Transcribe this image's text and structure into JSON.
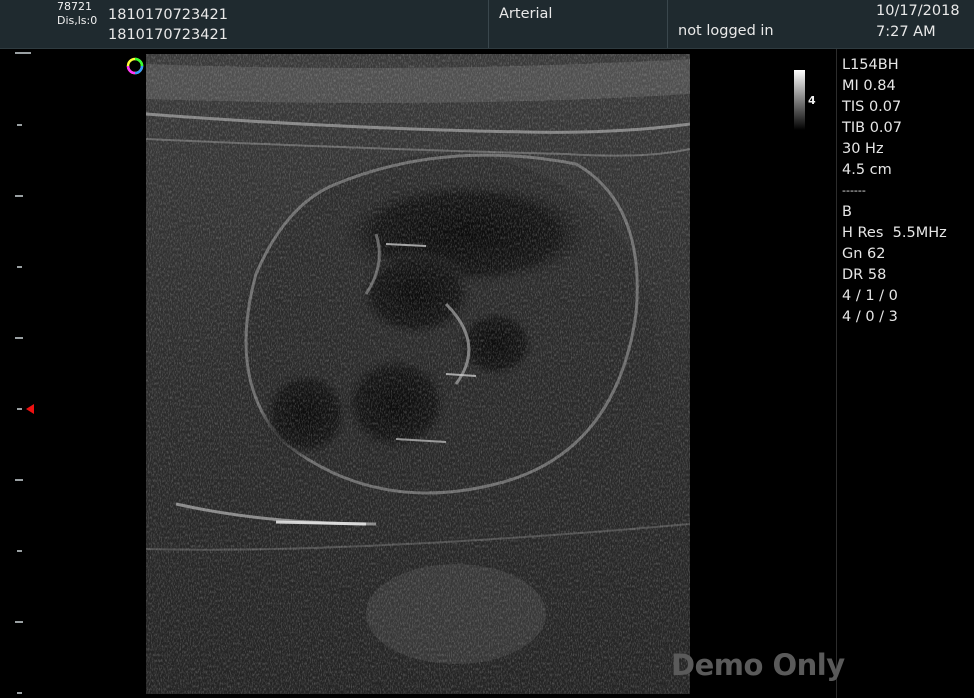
{
  "header": {
    "top_left_line1": "78721",
    "top_left_line2": "Dis,ls:0",
    "patient_id_1": "1810170723421",
    "patient_id_2": "1810170723421",
    "exam_type": "Arterial",
    "login_status": "not logged in",
    "date": "10/17/2018",
    "time": "7:27 AM"
  },
  "grayscale_bar": {
    "label": "4"
  },
  "parameters": [
    "L154BH",
    "MI 0.84",
    "TIS 0.07",
    "TIB 0.07",
    "30 Hz",
    "4.5 cm",
    "------",
    "B",
    "H Res  5.5MHz",
    "Gn 62",
    "DR 58",
    "4 / 1 / 0",
    "4 / 0 / 3"
  ],
  "watermark": "Demo Only",
  "icons": {
    "orientation": "orientation-marker-icon",
    "focus": "focus-marker-icon"
  },
  "colors": {
    "background": "#000000",
    "header": "#1f2a2f",
    "focus_marker": "#e11111"
  }
}
